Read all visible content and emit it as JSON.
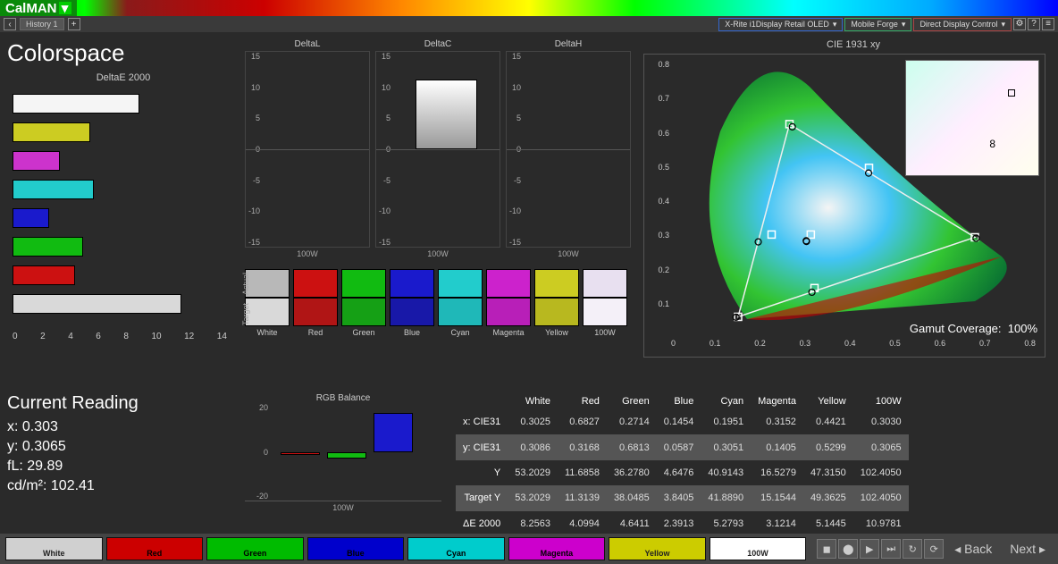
{
  "app": {
    "name": "CalMAN"
  },
  "toolbar": {
    "history": "History 1",
    "devices": [
      {
        "label": "X-Rite i1Display Retail OLED",
        "cls": "dp-blue"
      },
      {
        "label": "Mobile Forge",
        "cls": "dp-green"
      },
      {
        "label": "Direct Display Control",
        "cls": "dp-red"
      }
    ]
  },
  "title": "Colorspace",
  "chart_data": [
    {
      "id": "deltaE2000",
      "type": "bar",
      "title": "DeltaE 2000",
      "orientation": "horizontal",
      "xlim": [
        0,
        14
      ],
      "xticks": [
        0,
        2,
        4,
        6,
        8,
        10,
        12,
        14
      ],
      "bars": [
        {
          "color": "#f5f5f5",
          "value": 8.3
        },
        {
          "color": "#cccc22",
          "value": 5.1
        },
        {
          "color": "#cc33cc",
          "value": 3.1
        },
        {
          "color": "#22cccc",
          "value": 5.3
        },
        {
          "color": "#1a1acc",
          "value": 2.4
        },
        {
          "color": "#11bb11",
          "value": 4.6
        },
        {
          "color": "#cc1111",
          "value": 4.1
        },
        {
          "color": "#d9d9d9",
          "value": 11.0
        }
      ]
    },
    {
      "id": "deltaL",
      "type": "bar",
      "title": "DeltaL",
      "ylim": [
        -15,
        15
      ],
      "yticks": [
        15,
        10,
        5,
        0,
        -5,
        -10,
        -15
      ],
      "xlabel": "100W",
      "values": []
    },
    {
      "id": "deltaC",
      "type": "bar",
      "title": "DeltaC",
      "ylim": [
        -15,
        15
      ],
      "yticks": [
        15,
        10,
        5,
        0,
        -5,
        -10,
        -15
      ],
      "xlabel": "100W",
      "values": [
        {
          "x": "100W",
          "y": 12,
          "fill": "grad-white"
        }
      ]
    },
    {
      "id": "deltaH",
      "type": "bar",
      "title": "DeltaH",
      "ylim": [
        -15,
        15
      ],
      "yticks": [
        15,
        10,
        5,
        0,
        -5,
        -10,
        -15
      ],
      "xlabel": "100W",
      "values": []
    },
    {
      "id": "rgbBalance",
      "type": "bar",
      "title": "RGB Balance",
      "ylim": [
        -30,
        30
      ],
      "yticks": [
        20,
        0,
        -20
      ],
      "xlabel": "100W",
      "series": [
        {
          "name": "R",
          "color": "#cc1111",
          "value": -2
        },
        {
          "name": "G",
          "color": "#11bb11",
          "value": -4
        },
        {
          "name": "B",
          "color": "#1a1acc",
          "value": 24
        }
      ]
    },
    {
      "id": "cie1931",
      "type": "scatter",
      "title": "CIE 1931 xy",
      "xlim": [
        0,
        0.8
      ],
      "ylim": [
        0,
        0.9
      ],
      "xticks": [
        0,
        0.1,
        0.2,
        0.3,
        0.4,
        0.5,
        0.6,
        0.7,
        0.8
      ],
      "yticks": [
        "0.8",
        "0.7",
        "0.6",
        "0.5",
        "0.4",
        "0.3",
        "0.2",
        "0.1",
        ""
      ],
      "gamut_coverage": "100%",
      "target_points": [
        {
          "name": "Red",
          "x": 0.68,
          "y": 0.32
        },
        {
          "name": "Green",
          "x": 0.265,
          "y": 0.69
        },
        {
          "name": "Blue",
          "x": 0.15,
          "y": 0.06
        },
        {
          "name": "Cyan",
          "x": 0.225,
          "y": 0.329
        },
        {
          "name": "Magenta",
          "x": 0.321,
          "y": 0.154
        },
        {
          "name": "Yellow",
          "x": 0.443,
          "y": 0.547
        },
        {
          "name": "White",
          "x": 0.3127,
          "y": 0.329
        }
      ],
      "measured_points": [
        {
          "name": "Red",
          "x": 0.6827,
          "y": 0.3168
        },
        {
          "name": "Green",
          "x": 0.2714,
          "y": 0.6813
        },
        {
          "name": "Blue",
          "x": 0.1454,
          "y": 0.0587
        },
        {
          "name": "Cyan",
          "x": 0.1951,
          "y": 0.3051
        },
        {
          "name": "Magenta",
          "x": 0.3152,
          "y": 0.1405
        },
        {
          "name": "Yellow",
          "x": 0.4421,
          "y": 0.5299
        },
        {
          "name": "White",
          "x": 0.3025,
          "y": 0.3086
        },
        {
          "name": "100W",
          "x": 0.303,
          "y": 0.3065
        }
      ]
    }
  ],
  "swatches": {
    "row_labels": [
      "Actual",
      "Target"
    ],
    "items": [
      {
        "name": "White",
        "actual": "#b8b8b8",
        "target": "#d9d9d9"
      },
      {
        "name": "Red",
        "actual": "#cc1111",
        "target": "#b01515"
      },
      {
        "name": "Green",
        "actual": "#11bb11",
        "target": "#15a015"
      },
      {
        "name": "Blue",
        "actual": "#1a1acc",
        "target": "#1818a8"
      },
      {
        "name": "Cyan",
        "actual": "#22cccc",
        "target": "#1fb8b8"
      },
      {
        "name": "Magenta",
        "actual": "#cc22cc",
        "target": "#b81fb8"
      },
      {
        "name": "Yellow",
        "actual": "#cccc22",
        "target": "#b8b81f"
      },
      {
        "name": "100W",
        "actual": "#e8e0f0",
        "target": "#f4f0f8"
      }
    ]
  },
  "reading": {
    "title": "Current Reading",
    "rows": [
      {
        "k": "x:",
        "v": "0.303"
      },
      {
        "k": "y:",
        "v": "0.3065"
      },
      {
        "k": "fL:",
        "v": "29.89"
      },
      {
        "k": "cd/m²:",
        "v": "102.41"
      }
    ]
  },
  "table": {
    "cols": [
      "White",
      "Red",
      "Green",
      "Blue",
      "Cyan",
      "Magenta",
      "Yellow",
      "100W"
    ],
    "rows": [
      {
        "h": "x: CIE31",
        "v": [
          "0.3025",
          "0.6827",
          "0.2714",
          "0.1454",
          "0.1951",
          "0.3152",
          "0.4421",
          "0.3030"
        ]
      },
      {
        "h": "y: CIE31",
        "v": [
          "0.3086",
          "0.3168",
          "0.6813",
          "0.0587",
          "0.3051",
          "0.1405",
          "0.5299",
          "0.3065"
        ],
        "shade": true
      },
      {
        "h": "Y",
        "v": [
          "53.2029",
          "11.6858",
          "36.2780",
          "4.6476",
          "40.9143",
          "16.5279",
          "47.3150",
          "102.4050"
        ]
      },
      {
        "h": "Target Y",
        "v": [
          "53.2029",
          "11.3139",
          "38.0485",
          "3.8405",
          "41.8890",
          "15.1544",
          "49.3625",
          "102.4050"
        ],
        "shade": true
      },
      {
        "h": "ΔE 2000",
        "v": [
          "8.2563",
          "4.0994",
          "4.6411",
          "2.3913",
          "5.2793",
          "3.1214",
          "5.1445",
          "10.9781"
        ]
      }
    ]
  },
  "footer": {
    "swatches": [
      {
        "name": "White",
        "c": "#d0d0d0"
      },
      {
        "name": "Red",
        "c": "#cc0000"
      },
      {
        "name": "Green",
        "c": "#00bb00"
      },
      {
        "name": "Blue",
        "c": "#0000cc"
      },
      {
        "name": "Cyan",
        "c": "#00cccc"
      },
      {
        "name": "Magenta",
        "c": "#cc00cc"
      },
      {
        "name": "Yellow",
        "c": "#cccc00"
      },
      {
        "name": "100W",
        "c": "#ffffff"
      }
    ],
    "nav": {
      "back": "Back",
      "next": "Next"
    }
  },
  "gamut_label": "Gamut Coverage:"
}
